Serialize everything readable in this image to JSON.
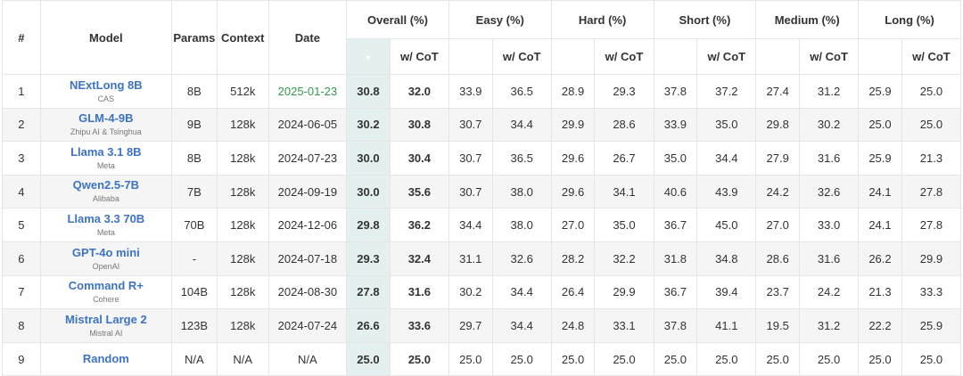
{
  "header": {
    "rank": "#",
    "model": "Model",
    "params": "Params",
    "context": "Context",
    "date": "Date",
    "groups": [
      {
        "label": "Overall (%)",
        "sub": [
          "",
          "w/ CoT"
        ]
      },
      {
        "label": "Easy (%)",
        "sub": [
          "",
          "w/ CoT"
        ]
      },
      {
        "label": "Hard (%)",
        "sub": [
          "",
          "w/ CoT"
        ]
      },
      {
        "label": "Short (%)",
        "sub": [
          "",
          "w/ CoT"
        ]
      },
      {
        "label": "Medium (%)",
        "sub": [
          "",
          "w/ CoT"
        ]
      },
      {
        "label": "Long (%)",
        "sub": [
          "",
          "w/ CoT"
        ]
      }
    ]
  },
  "colors": {
    "model_link": "#3d73c4",
    "recent_date": "#35984b",
    "highlight_column": "#e3f0ef"
  },
  "rows": [
    {
      "rank": "1",
      "model": "NExtLong 8B",
      "org": "CAS",
      "params": "8B",
      "context": "512k",
      "date": "2025-01-23",
      "recent": true,
      "scores": [
        "30.8",
        "32.0",
        "33.9",
        "36.5",
        "28.9",
        "29.3",
        "37.8",
        "37.2",
        "27.4",
        "31.2",
        "25.9",
        "25.0"
      ]
    },
    {
      "rank": "2",
      "model": "GLM-4-9B",
      "org": "Zhipu AI & Tsinghua",
      "params": "9B",
      "context": "128k",
      "date": "2024-06-05",
      "recent": false,
      "scores": [
        "30.2",
        "30.8",
        "30.7",
        "34.4",
        "29.9",
        "28.6",
        "33.9",
        "35.0",
        "29.8",
        "30.2",
        "25.0",
        "25.0"
      ]
    },
    {
      "rank": "3",
      "model": "Llama 3.1 8B",
      "org": "Meta",
      "params": "8B",
      "context": "128k",
      "date": "2024-07-23",
      "recent": false,
      "scores": [
        "30.0",
        "30.4",
        "30.7",
        "36.5",
        "29.6",
        "26.7",
        "35.0",
        "34.4",
        "27.9",
        "31.6",
        "25.9",
        "21.3"
      ]
    },
    {
      "rank": "4",
      "model": "Qwen2.5-7B",
      "org": "Alibaba",
      "params": "7B",
      "context": "128k",
      "date": "2024-09-19",
      "recent": false,
      "scores": [
        "30.0",
        "35.6",
        "30.7",
        "38.0",
        "29.6",
        "34.1",
        "40.6",
        "43.9",
        "24.2",
        "32.6",
        "24.1",
        "27.8"
      ]
    },
    {
      "rank": "5",
      "model": "Llama 3.3 70B",
      "org": "Meta",
      "params": "70B",
      "context": "128k",
      "date": "2024-12-06",
      "recent": false,
      "scores": [
        "29.8",
        "36.2",
        "34.4",
        "38.0",
        "27.0",
        "35.0",
        "36.7",
        "45.0",
        "27.0",
        "33.0",
        "24.1",
        "27.8"
      ]
    },
    {
      "rank": "6",
      "model": "GPT-4o mini",
      "org": "OpenAI",
      "params": "-",
      "context": "128k",
      "date": "2024-07-18",
      "recent": false,
      "scores": [
        "29.3",
        "32.4",
        "31.1",
        "32.6",
        "28.2",
        "32.2",
        "31.8",
        "34.8",
        "28.6",
        "31.6",
        "26.2",
        "29.9"
      ]
    },
    {
      "rank": "7",
      "model": "Command R+",
      "org": "Cohere",
      "params": "104B",
      "context": "128k",
      "date": "2024-08-30",
      "recent": false,
      "scores": [
        "27.8",
        "31.6",
        "30.2",
        "34.4",
        "26.4",
        "29.9",
        "36.7",
        "39.4",
        "23.7",
        "24.2",
        "21.3",
        "33.3"
      ]
    },
    {
      "rank": "8",
      "model": "Mistral Large 2",
      "org": "Mistral AI",
      "params": "123B",
      "context": "128k",
      "date": "2024-07-24",
      "recent": false,
      "scores": [
        "26.6",
        "33.6",
        "29.7",
        "34.4",
        "24.8",
        "33.1",
        "37.8",
        "41.1",
        "19.5",
        "31.2",
        "22.2",
        "25.9"
      ]
    },
    {
      "rank": "9",
      "model": "Random",
      "org": "",
      "params": "N/A",
      "context": "N/A",
      "date": "N/A",
      "recent": false,
      "scores": [
        "25.0",
        "25.0",
        "25.0",
        "25.0",
        "25.0",
        "25.0",
        "25.0",
        "25.0",
        "25.0",
        "25.0",
        "25.0",
        "25.0"
      ]
    }
  ]
}
